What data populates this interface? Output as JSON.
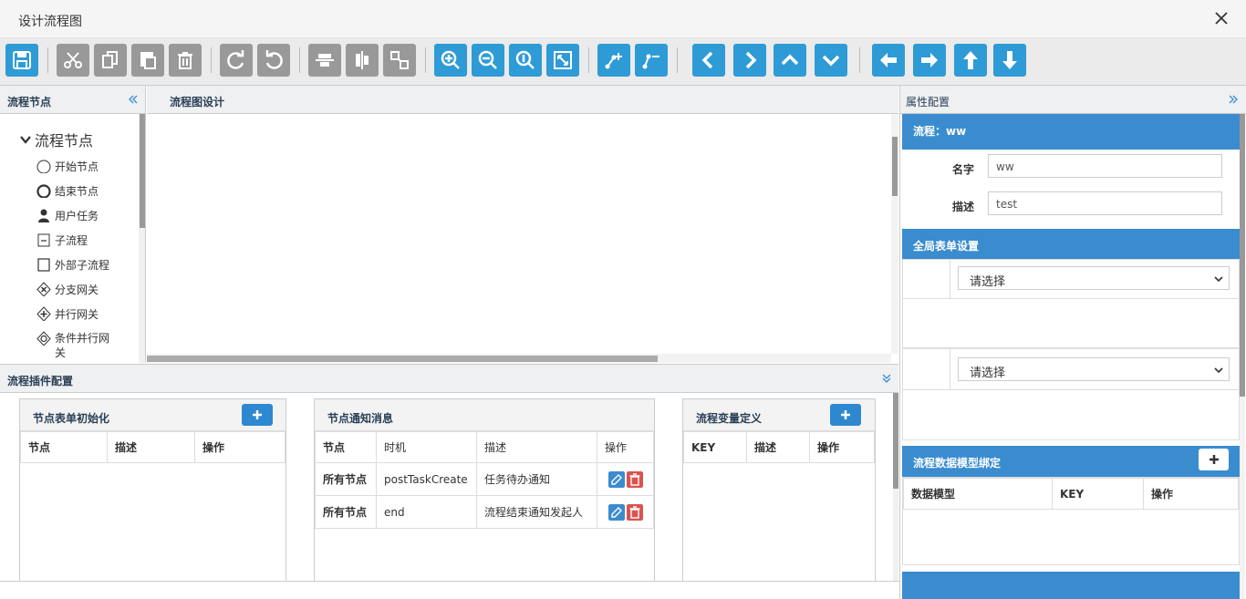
{
  "window": {
    "title": "设计流程图"
  },
  "toolbar": {
    "buttons": [
      {
        "name": "save"
      },
      {
        "name": "cut"
      },
      {
        "name": "copy"
      },
      {
        "name": "paste"
      },
      {
        "name": "delete"
      },
      {
        "name": "redo"
      },
      {
        "name": "undo"
      },
      {
        "name": "align-horizontal"
      },
      {
        "name": "align-vertical"
      },
      {
        "name": "auto-layout"
      },
      {
        "name": "zoom-in"
      },
      {
        "name": "zoom-out"
      },
      {
        "name": "zoom-actual"
      },
      {
        "name": "fit"
      },
      {
        "name": "add-line"
      },
      {
        "name": "remove-line"
      },
      {
        "name": "chevron-left"
      },
      {
        "name": "chevron-right"
      },
      {
        "name": "chevron-up"
      },
      {
        "name": "chevron-down"
      },
      {
        "name": "arrow-left"
      },
      {
        "name": "arrow-right"
      },
      {
        "name": "arrow-up"
      },
      {
        "name": "arrow-down"
      }
    ],
    "colors": {
      "gray": "#999999",
      "blue": "#2e9bd6"
    }
  },
  "left_panel": {
    "title": "流程节点",
    "tree_root": "流程节点",
    "nodes": [
      "开始节点",
      "结束节点",
      "用户任务",
      "子流程",
      "外部子流程",
      "分支网关",
      "并行网关",
      "条件并行网关"
    ]
  },
  "canvas_panel": {
    "title": "流程图设计"
  },
  "plugin_panel": {
    "title": "流程插件配置",
    "form_init": {
      "title": "节点表单初始化",
      "headers": [
        "节点",
        "描述",
        "操作"
      ]
    },
    "notify": {
      "title": "节点通知消息",
      "headers": [
        "节点",
        "时机",
        "描述",
        "操作"
      ],
      "rows": [
        {
          "node": "所有节点",
          "timing": "postTaskCreate",
          "desc": "任务待办通知"
        },
        {
          "node": "所有节点",
          "timing": "end",
          "desc": "流程结束通知发起人"
        }
      ]
    },
    "variables": {
      "title": "流程变量定义",
      "headers": [
        "KEY",
        "描述",
        "操作"
      ]
    }
  },
  "right_panel": {
    "title": "属性配置",
    "process_header": "流程：ww",
    "name_label": "名字",
    "name_value": "ww",
    "desc_label": "描述",
    "desc_value": "test",
    "global_form": {
      "title": "全局表单设置",
      "select1": "请选择",
      "select2": "请选择"
    },
    "data_model": {
      "title": "流程数据模型绑定",
      "headers": [
        "数据模型",
        "KEY",
        "操作"
      ]
    }
  },
  "accent_color": "#3a8ccf"
}
